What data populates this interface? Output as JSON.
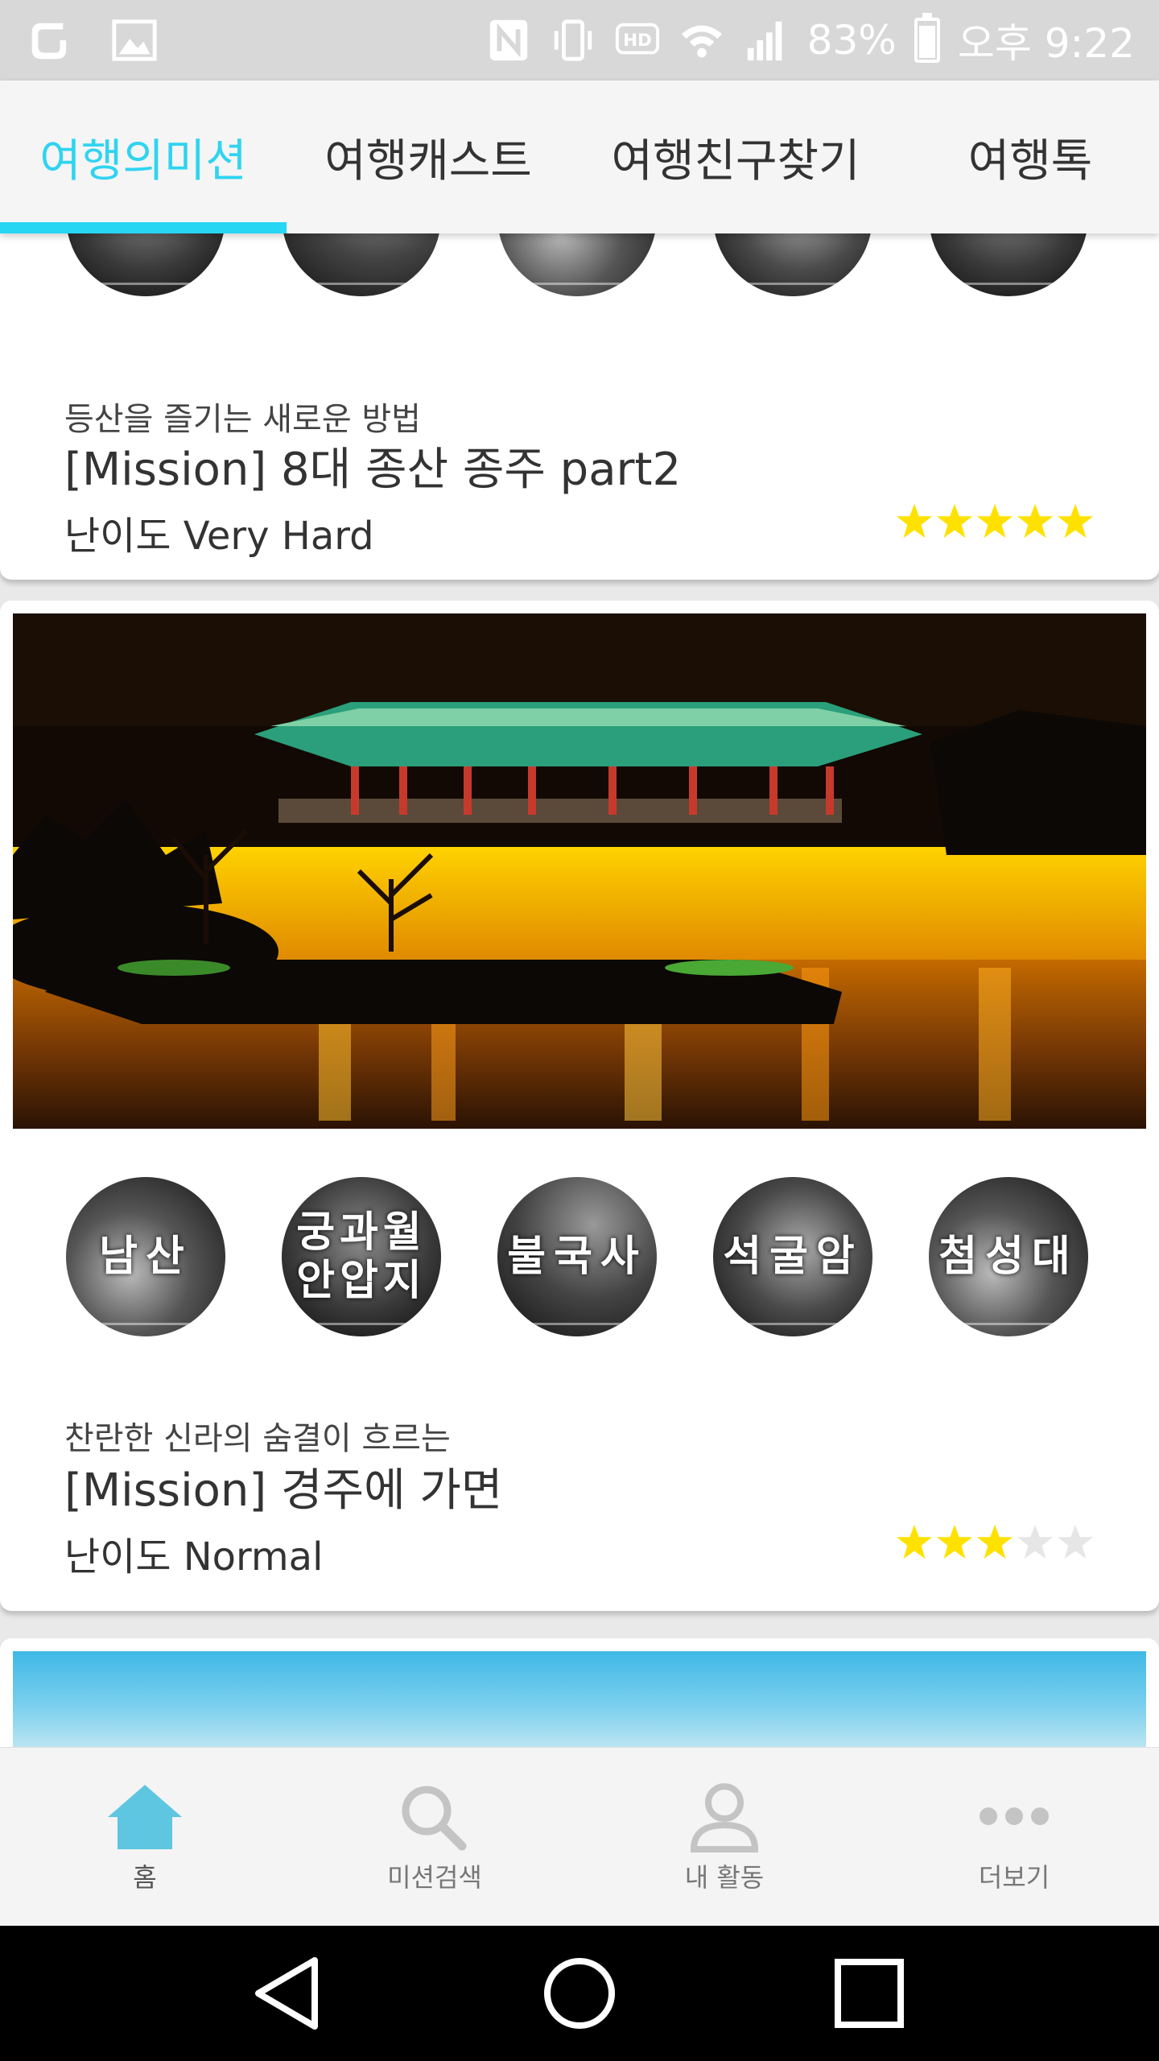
{
  "status_bar": {
    "battery_level": "83%",
    "time": "오후 9:22",
    "icons": [
      "app-icon",
      "image-icon",
      "nfc-icon",
      "vibrate-icon",
      "hd-icon",
      "wifi-icon",
      "signal-icon",
      "battery-icon"
    ]
  },
  "tabs": [
    {
      "label": "여행의미션",
      "active": true
    },
    {
      "label": "여행캐스트",
      "active": false
    },
    {
      "label": "여행친구찾기",
      "active": false
    },
    {
      "label": "여행톡",
      "active": false
    }
  ],
  "cards": [
    {
      "subtitle": "등산을 즐기는 새로운 방법",
      "title": "[Mission] 8대 종산 종주 part2",
      "difficulty": "난이도 Very Hard",
      "rating": 5,
      "max_rating": 5,
      "spots": [
        "",
        "",
        "",
        "",
        ""
      ]
    },
    {
      "subtitle": "찬란한 신라의 숨결이 흐르는",
      "title": "[Mission] 경주에 가면",
      "difficulty": "난이도 Normal",
      "rating": 3,
      "max_rating": 5,
      "spots": [
        "남산",
        "궁과월\n안압지",
        "불국사",
        "석굴암",
        "첨성대"
      ]
    }
  ],
  "bottom_nav": [
    {
      "label": "홈",
      "icon": "home-icon",
      "active": true
    },
    {
      "label": "미션검색",
      "icon": "search-icon",
      "active": false
    },
    {
      "label": "내 활동",
      "icon": "person-icon",
      "active": false
    },
    {
      "label": "더보기",
      "icon": "more-icon",
      "active": false
    }
  ],
  "colors": {
    "accent": "#26d6f2",
    "star_filled": "#ffe100",
    "star_empty": "#e6e6e6",
    "home_active": "#5ec6e0"
  },
  "system_nav": [
    "back-icon",
    "home-circle-icon",
    "recents-icon"
  ]
}
